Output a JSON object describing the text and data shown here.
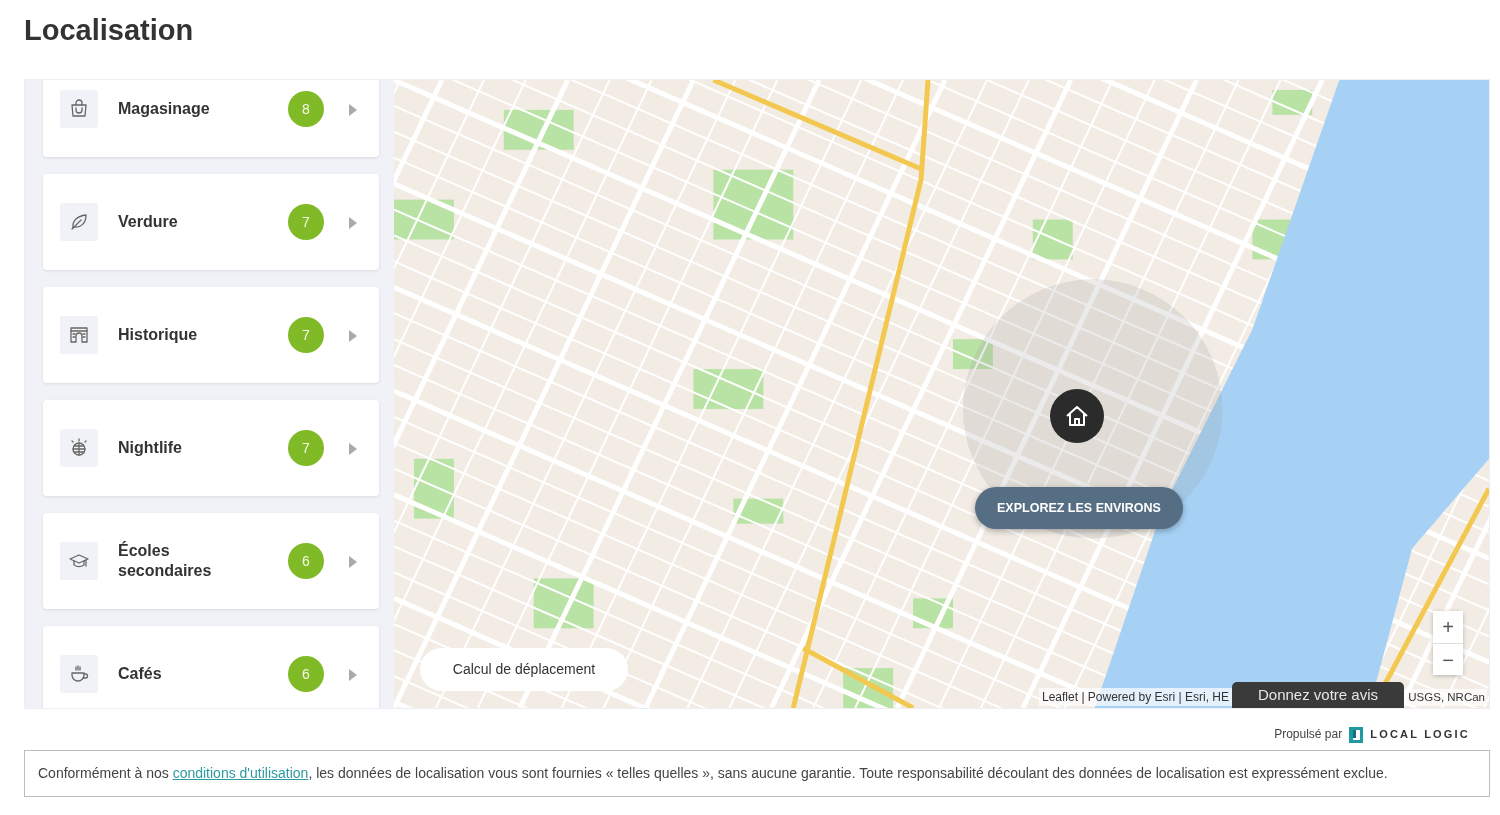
{
  "title": "Localisation",
  "categories": [
    {
      "label": "Magasinage",
      "count": "8"
    },
    {
      "label": "Verdure",
      "count": "7"
    },
    {
      "label": "Historique",
      "count": "7"
    },
    {
      "label": "Nightlife",
      "count": "7"
    },
    {
      "label": "Écoles secondaires",
      "count": "6"
    },
    {
      "label": "Cafés",
      "count": "6"
    }
  ],
  "map": {
    "explore_button": "EXPLOREZ LES ENVIRONS",
    "travel_button": "Calcul de déplacement",
    "zoom_in": "+",
    "zoom_out": "−",
    "attribution_left": "Leaflet | Powered by Esri | Esri, HE",
    "attribution_right": "USGS, NRCan",
    "feedback_button": "Donnez votre avis"
  },
  "powered_by": {
    "text": "Propulsé par",
    "brand": "LOCAL LOGIC"
  },
  "disclaimer": {
    "before": "Conformément à nos ",
    "link": "conditions d'utilisation",
    "after": ", les données de localisation vous sont fournies « telles quelles », sans aucune garantie. Toute responsabilité découlant des données de localisation est expressément exclue."
  }
}
